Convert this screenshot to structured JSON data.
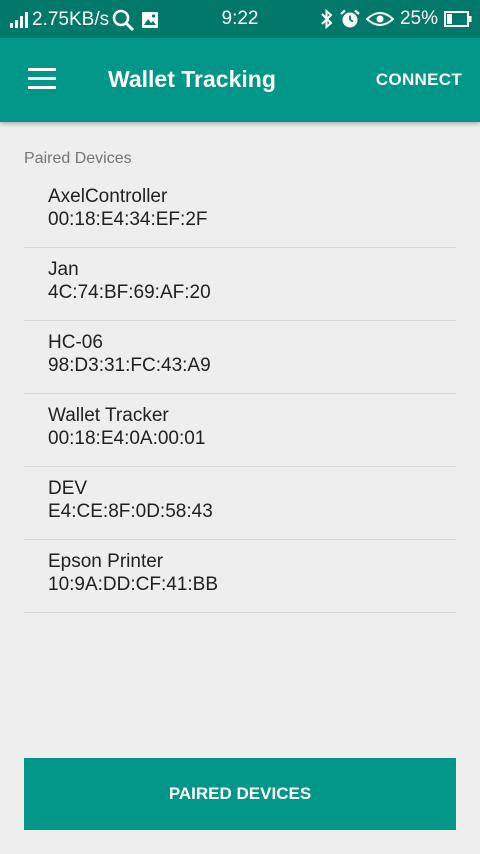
{
  "status_bar": {
    "network_speed": "2.75KB/s",
    "time": "9:22",
    "battery": "25%",
    "icons": [
      "signal-icon",
      "search-icon",
      "image-icon",
      "bluetooth-icon",
      "alarm-icon",
      "eye-icon",
      "battery-icon"
    ]
  },
  "app_bar": {
    "title": "Wallet Tracking",
    "action": "CONNECT",
    "menu_icon": "hamburger-menu-icon"
  },
  "section": {
    "label": "Paired Devices"
  },
  "devices": [
    {
      "name": "AxelController",
      "address": "00:18:E4:34:EF:2F"
    },
    {
      "name": "Jan",
      "address": "4C:74:BF:69:AF:20"
    },
    {
      "name": "HC-06",
      "address": "98:D3:31:FC:43:A9"
    },
    {
      "name": "Wallet Tracker",
      "address": "00:18:E4:0A:00:01"
    },
    {
      "name": "DEV",
      "address": "E4:CE:8F:0D:58:43"
    },
    {
      "name": "Epson Printer",
      "address": "10:9A:DD:CF:41:BB"
    }
  ],
  "bottom_button": {
    "label": "PAIRED DEVICES"
  },
  "colors": {
    "status_bar": "#00796b",
    "primary": "#009688",
    "background": "#eeeeee"
  }
}
